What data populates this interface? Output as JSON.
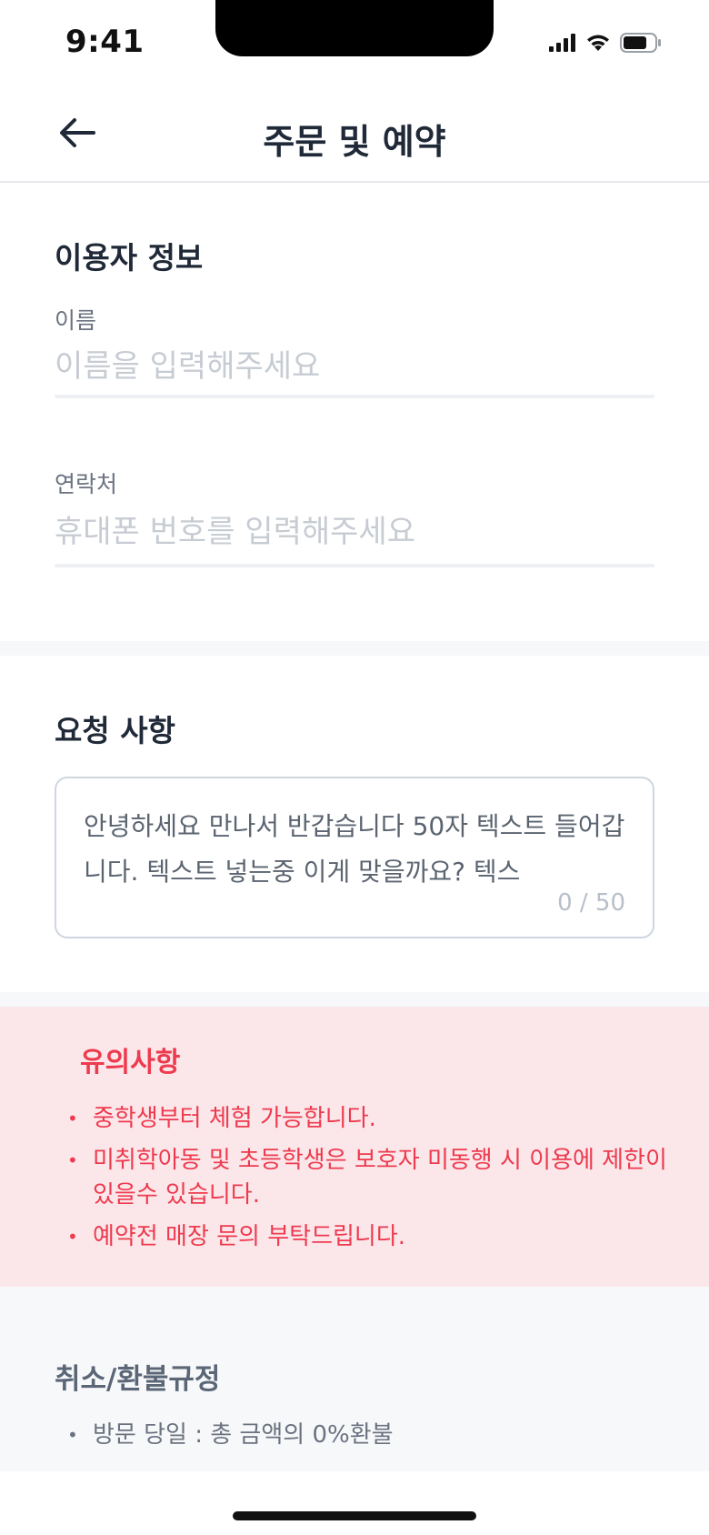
{
  "status_bar": {
    "time": "9:41",
    "icons": [
      "signal-icon",
      "wifi-icon",
      "battery-icon"
    ]
  },
  "header": {
    "back_icon": "arrow-left-icon",
    "title": "주문 및 예약"
  },
  "user_info": {
    "title": "이용자 정보",
    "name": {
      "label": "이름",
      "value": "",
      "placeholder": "이름을 입력해주세요"
    },
    "contact": {
      "label": "연락처",
      "value": "",
      "placeholder": "휴대폰 번호를 입력해주세요"
    }
  },
  "request": {
    "title": "요청 사항",
    "text": "안녕하세요 만나서 반갑습니다 50자 텍스트 들어갑니다. 텍스트 넣는중 이게 맞을까요? 텍스",
    "counter": "0 / 50"
  },
  "notice": {
    "title": "유의사항",
    "items": [
      "중학생부터 체험 가능합니다.",
      "미취학아동 및 초등학생은 보호자 미동행 시 이용에 제한이 있을수 있습니다.",
      "예약전 매장 문의 부탁드립니다."
    ]
  },
  "refund": {
    "title": "취소/환불규정",
    "items": [
      "방문 당일 : 총 금액의 0%환불"
    ]
  },
  "colors": {
    "notice_bg": "#fbe7ea",
    "notice_text": "#ee3a4e",
    "refund_bg": "#f7f8fa",
    "text_primary": "#1f2937",
    "placeholder": "#c7ccd3"
  }
}
